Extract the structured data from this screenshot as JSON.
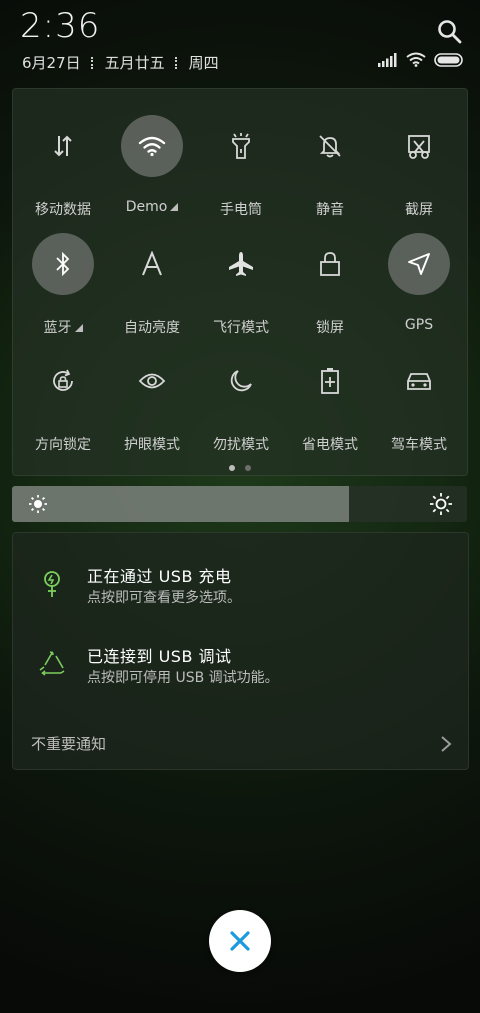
{
  "status_bar": {
    "time": "2:36",
    "date": "6月27日",
    "lunar_date": "五月廿五",
    "weekday": "周四",
    "icons": [
      "signal-icon",
      "wifi-icon",
      "battery-icon"
    ]
  },
  "quick_settings": {
    "tiles": [
      {
        "label": "移动数据",
        "icon": "data-arrows-icon",
        "active": false
      },
      {
        "label": "Demo",
        "icon": "wifi-icon",
        "active": true,
        "expandable": true
      },
      {
        "label": "手电筒",
        "icon": "flashlight-icon",
        "active": false
      },
      {
        "label": "静音",
        "icon": "mute-bell-icon",
        "active": false
      },
      {
        "label": "截屏",
        "icon": "screenshot-icon",
        "active": false
      },
      {
        "label": "蓝牙",
        "icon": "bluetooth-icon",
        "active": true,
        "expandable": true
      },
      {
        "label": "自动亮度",
        "icon": "auto-brightness-icon",
        "active": false
      },
      {
        "label": "飞行模式",
        "icon": "airplane-icon",
        "active": false
      },
      {
        "label": "锁屏",
        "icon": "lock-icon",
        "active": false
      },
      {
        "label": "GPS",
        "icon": "gps-icon",
        "active": true
      },
      {
        "label": "方向锁定",
        "icon": "rotation-lock-icon",
        "active": false
      },
      {
        "label": "护眼模式",
        "icon": "eye-icon",
        "active": false
      },
      {
        "label": "勿扰模式",
        "icon": "moon-icon",
        "active": false
      },
      {
        "label": "省电模式",
        "icon": "battery-saver-icon",
        "active": false
      },
      {
        "label": "驾车模式",
        "icon": "car-icon",
        "active": false
      }
    ],
    "page_count": 2,
    "current_page": 1
  },
  "brightness": {
    "level": 0.74,
    "icons": [
      "sun-low-icon",
      "sun-high-icon"
    ]
  },
  "notifications": {
    "items": [
      {
        "title": "正在通过 USB 充电",
        "subtitle": "点按即可查看更多选项。",
        "icon": "usb-charge-icon"
      },
      {
        "title": "已连接到 USB 调试",
        "subtitle": "点按即可停用 USB 调试功能。",
        "icon": "usb-debug-icon"
      }
    ],
    "unimportant_label": "不重要通知"
  },
  "close_button": {
    "icon": "close-icon",
    "color": "#1a9be0"
  }
}
